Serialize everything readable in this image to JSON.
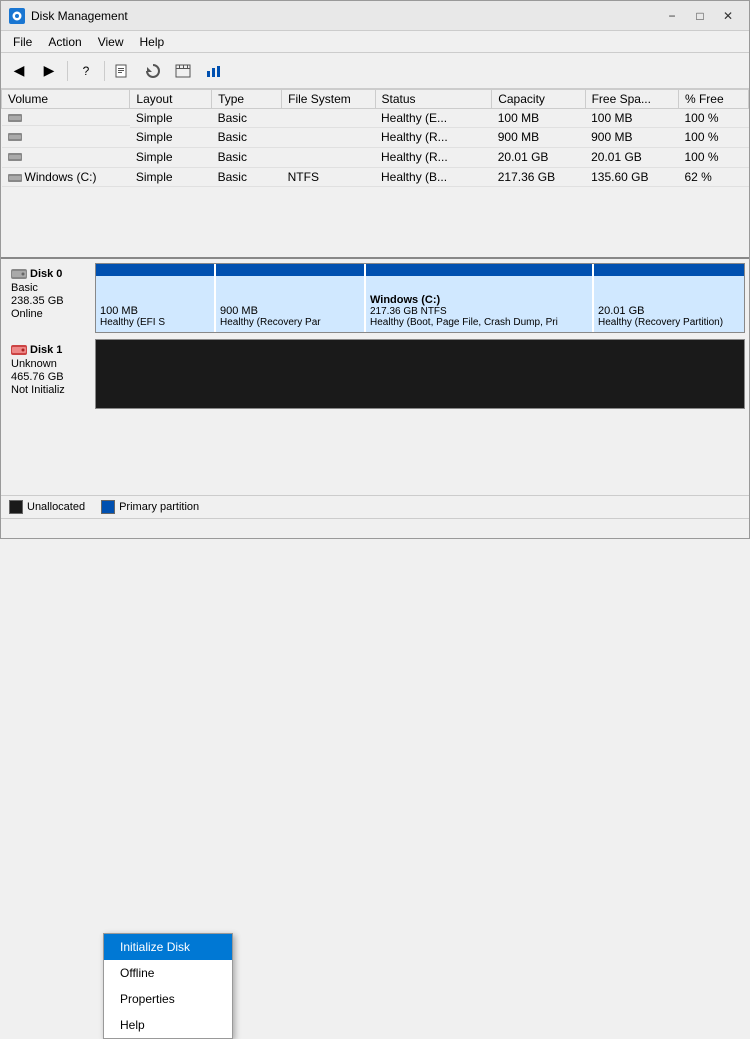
{
  "window": {
    "title": "Disk Management",
    "title_icon": "💿"
  },
  "menu": {
    "items": [
      "File",
      "Action",
      "View",
      "Help"
    ]
  },
  "toolbar": {
    "buttons": [
      "◀",
      "▶",
      "📋",
      "?",
      "📄",
      "🔄",
      "📊",
      "📈"
    ]
  },
  "table": {
    "headers": [
      "Volume",
      "Layout",
      "Type",
      "File System",
      "Status",
      "Capacity",
      "Free Spa...",
      "% Free"
    ],
    "rows": [
      {
        "volume": "",
        "layout": "Simple",
        "type": "Basic",
        "filesystem": "",
        "status": "Healthy (E...",
        "capacity": "100 MB",
        "free": "100 MB",
        "pct_free": "100 %"
      },
      {
        "volume": "",
        "layout": "Simple",
        "type": "Basic",
        "filesystem": "",
        "status": "Healthy (R...",
        "capacity": "900 MB",
        "free": "900 MB",
        "pct_free": "100 %"
      },
      {
        "volume": "",
        "layout": "Simple",
        "type": "Basic",
        "filesystem": "",
        "status": "Healthy (R...",
        "capacity": "20.01 GB",
        "free": "20.01 GB",
        "pct_free": "100 %"
      },
      {
        "volume": "Windows (C:)",
        "layout": "Simple",
        "type": "Basic",
        "filesystem": "NTFS",
        "status": "Healthy (B...",
        "capacity": "217.36 GB",
        "free": "135.60 GB",
        "pct_free": "62 %"
      }
    ]
  },
  "disks": [
    {
      "name": "Disk 0",
      "type": "Basic",
      "size": "238.35 GB",
      "status": "Online",
      "partitions": [
        {
          "label": "100 MB",
          "sublabel": "Healthy (EFI S",
          "type": "primary",
          "width_pct": 17
        },
        {
          "label": "900 MB",
          "sublabel": "Healthy (Recovery Par",
          "type": "primary",
          "width_pct": 22
        },
        {
          "label": "Windows (C:)",
          "sublabel": "217.36 GB NTFS",
          "detail": "Healthy (Boot, Page File, Crash Dump, Pri",
          "type": "primary_bold",
          "width_pct": 38
        },
        {
          "label": "20.01 GB",
          "sublabel": "Healthy (Recovery Partition)",
          "type": "primary",
          "width_pct": 23
        }
      ]
    },
    {
      "name": "Disk 1",
      "type": "Unknown",
      "size": "465.76 GB",
      "status": "Not Initializ",
      "partitions": [
        {
          "label": "",
          "sublabel": "",
          "type": "unallocated",
          "width_pct": 100
        }
      ]
    }
  ],
  "context_menu": {
    "items": [
      "Initialize Disk",
      "Offline",
      "Properties",
      "Help"
    ]
  },
  "legend": {
    "items": [
      {
        "color": "#1a1a1a",
        "label": "Unallocated"
      },
      {
        "color": "#0050b0",
        "label": "Primary partition"
      }
    ]
  },
  "status_bar": {
    "text": ""
  }
}
